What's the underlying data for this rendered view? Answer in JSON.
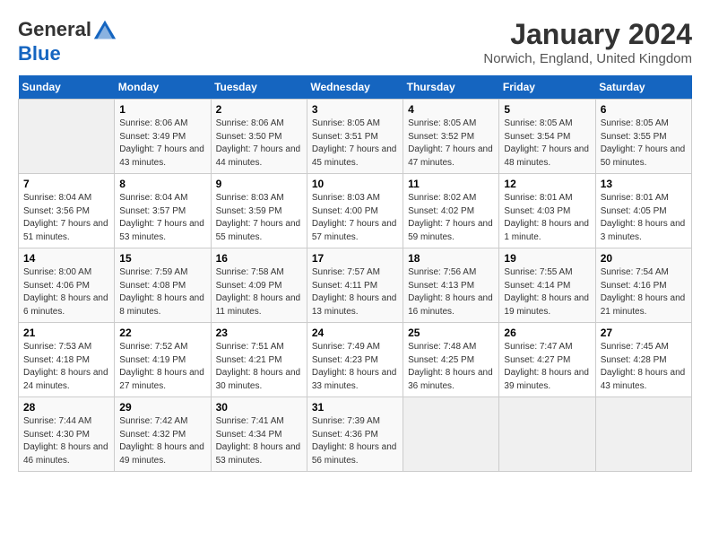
{
  "header": {
    "logo_general": "General",
    "logo_blue": "Blue",
    "month_title": "January 2024",
    "location": "Norwich, England, United Kingdom"
  },
  "weekdays": [
    "Sunday",
    "Monday",
    "Tuesday",
    "Wednesday",
    "Thursday",
    "Friday",
    "Saturday"
  ],
  "weeks": [
    [
      {
        "day": "",
        "sunrise": "",
        "sunset": "",
        "daylight": ""
      },
      {
        "day": "1",
        "sunrise": "Sunrise: 8:06 AM",
        "sunset": "Sunset: 3:49 PM",
        "daylight": "Daylight: 7 hours and 43 minutes."
      },
      {
        "day": "2",
        "sunrise": "Sunrise: 8:06 AM",
        "sunset": "Sunset: 3:50 PM",
        "daylight": "Daylight: 7 hours and 44 minutes."
      },
      {
        "day": "3",
        "sunrise": "Sunrise: 8:05 AM",
        "sunset": "Sunset: 3:51 PM",
        "daylight": "Daylight: 7 hours and 45 minutes."
      },
      {
        "day": "4",
        "sunrise": "Sunrise: 8:05 AM",
        "sunset": "Sunset: 3:52 PM",
        "daylight": "Daylight: 7 hours and 47 minutes."
      },
      {
        "day": "5",
        "sunrise": "Sunrise: 8:05 AM",
        "sunset": "Sunset: 3:54 PM",
        "daylight": "Daylight: 7 hours and 48 minutes."
      },
      {
        "day": "6",
        "sunrise": "Sunrise: 8:05 AM",
        "sunset": "Sunset: 3:55 PM",
        "daylight": "Daylight: 7 hours and 50 minutes."
      }
    ],
    [
      {
        "day": "7",
        "sunrise": "Sunrise: 8:04 AM",
        "sunset": "Sunset: 3:56 PM",
        "daylight": "Daylight: 7 hours and 51 minutes."
      },
      {
        "day": "8",
        "sunrise": "Sunrise: 8:04 AM",
        "sunset": "Sunset: 3:57 PM",
        "daylight": "Daylight: 7 hours and 53 minutes."
      },
      {
        "day": "9",
        "sunrise": "Sunrise: 8:03 AM",
        "sunset": "Sunset: 3:59 PM",
        "daylight": "Daylight: 7 hours and 55 minutes."
      },
      {
        "day": "10",
        "sunrise": "Sunrise: 8:03 AM",
        "sunset": "Sunset: 4:00 PM",
        "daylight": "Daylight: 7 hours and 57 minutes."
      },
      {
        "day": "11",
        "sunrise": "Sunrise: 8:02 AM",
        "sunset": "Sunset: 4:02 PM",
        "daylight": "Daylight: 7 hours and 59 minutes."
      },
      {
        "day": "12",
        "sunrise": "Sunrise: 8:01 AM",
        "sunset": "Sunset: 4:03 PM",
        "daylight": "Daylight: 8 hours and 1 minute."
      },
      {
        "day": "13",
        "sunrise": "Sunrise: 8:01 AM",
        "sunset": "Sunset: 4:05 PM",
        "daylight": "Daylight: 8 hours and 3 minutes."
      }
    ],
    [
      {
        "day": "14",
        "sunrise": "Sunrise: 8:00 AM",
        "sunset": "Sunset: 4:06 PM",
        "daylight": "Daylight: 8 hours and 6 minutes."
      },
      {
        "day": "15",
        "sunrise": "Sunrise: 7:59 AM",
        "sunset": "Sunset: 4:08 PM",
        "daylight": "Daylight: 8 hours and 8 minutes."
      },
      {
        "day": "16",
        "sunrise": "Sunrise: 7:58 AM",
        "sunset": "Sunset: 4:09 PM",
        "daylight": "Daylight: 8 hours and 11 minutes."
      },
      {
        "day": "17",
        "sunrise": "Sunrise: 7:57 AM",
        "sunset": "Sunset: 4:11 PM",
        "daylight": "Daylight: 8 hours and 13 minutes."
      },
      {
        "day": "18",
        "sunrise": "Sunrise: 7:56 AM",
        "sunset": "Sunset: 4:13 PM",
        "daylight": "Daylight: 8 hours and 16 minutes."
      },
      {
        "day": "19",
        "sunrise": "Sunrise: 7:55 AM",
        "sunset": "Sunset: 4:14 PM",
        "daylight": "Daylight: 8 hours and 19 minutes."
      },
      {
        "day": "20",
        "sunrise": "Sunrise: 7:54 AM",
        "sunset": "Sunset: 4:16 PM",
        "daylight": "Daylight: 8 hours and 21 minutes."
      }
    ],
    [
      {
        "day": "21",
        "sunrise": "Sunrise: 7:53 AM",
        "sunset": "Sunset: 4:18 PM",
        "daylight": "Daylight: 8 hours and 24 minutes."
      },
      {
        "day": "22",
        "sunrise": "Sunrise: 7:52 AM",
        "sunset": "Sunset: 4:19 PM",
        "daylight": "Daylight: 8 hours and 27 minutes."
      },
      {
        "day": "23",
        "sunrise": "Sunrise: 7:51 AM",
        "sunset": "Sunset: 4:21 PM",
        "daylight": "Daylight: 8 hours and 30 minutes."
      },
      {
        "day": "24",
        "sunrise": "Sunrise: 7:49 AM",
        "sunset": "Sunset: 4:23 PM",
        "daylight": "Daylight: 8 hours and 33 minutes."
      },
      {
        "day": "25",
        "sunrise": "Sunrise: 7:48 AM",
        "sunset": "Sunset: 4:25 PM",
        "daylight": "Daylight: 8 hours and 36 minutes."
      },
      {
        "day": "26",
        "sunrise": "Sunrise: 7:47 AM",
        "sunset": "Sunset: 4:27 PM",
        "daylight": "Daylight: 8 hours and 39 minutes."
      },
      {
        "day": "27",
        "sunrise": "Sunrise: 7:45 AM",
        "sunset": "Sunset: 4:28 PM",
        "daylight": "Daylight: 8 hours and 43 minutes."
      }
    ],
    [
      {
        "day": "28",
        "sunrise": "Sunrise: 7:44 AM",
        "sunset": "Sunset: 4:30 PM",
        "daylight": "Daylight: 8 hours and 46 minutes."
      },
      {
        "day": "29",
        "sunrise": "Sunrise: 7:42 AM",
        "sunset": "Sunset: 4:32 PM",
        "daylight": "Daylight: 8 hours and 49 minutes."
      },
      {
        "day": "30",
        "sunrise": "Sunrise: 7:41 AM",
        "sunset": "Sunset: 4:34 PM",
        "daylight": "Daylight: 8 hours and 53 minutes."
      },
      {
        "day": "31",
        "sunrise": "Sunrise: 7:39 AM",
        "sunset": "Sunset: 4:36 PM",
        "daylight": "Daylight: 8 hours and 56 minutes."
      },
      {
        "day": "",
        "sunrise": "",
        "sunset": "",
        "daylight": ""
      },
      {
        "day": "",
        "sunrise": "",
        "sunset": "",
        "daylight": ""
      },
      {
        "day": "",
        "sunrise": "",
        "sunset": "",
        "daylight": ""
      }
    ]
  ]
}
